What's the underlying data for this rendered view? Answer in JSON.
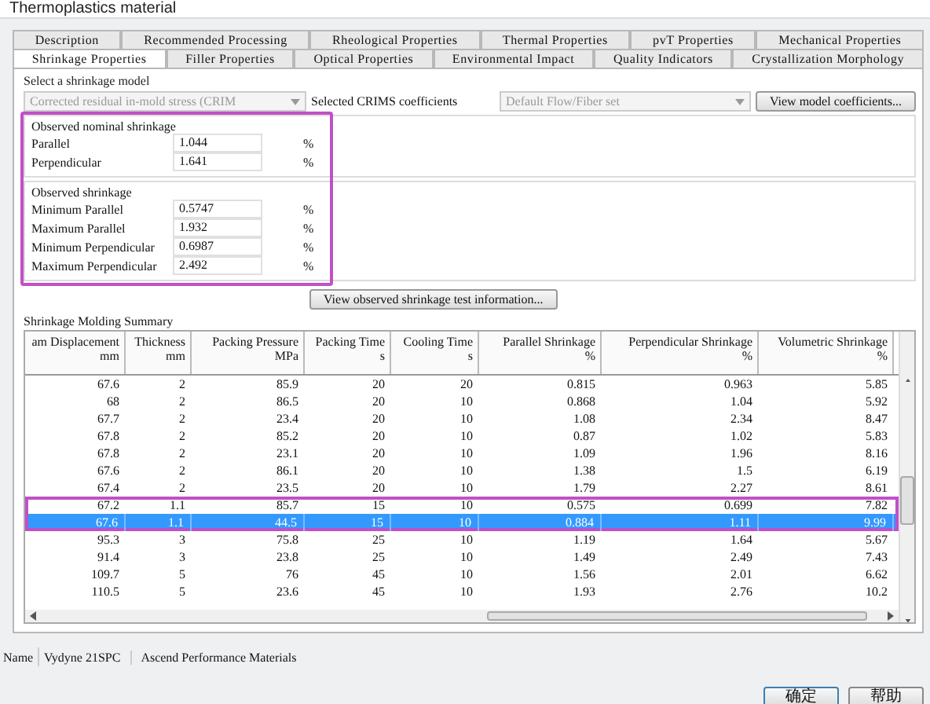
{
  "window": {
    "title": "Thermoplastics material"
  },
  "tab_rows": [
    {
      "tabs": [
        {
          "label": "Description",
          "selected": false
        },
        {
          "label": "Recommended Processing",
          "selected": false
        },
        {
          "label": "Rheological Properties",
          "selected": false
        },
        {
          "label": "Thermal Properties",
          "selected": false
        },
        {
          "label": "pvT Properties",
          "selected": false
        },
        {
          "label": "Mechanical Properties",
          "selected": false
        }
      ]
    },
    {
      "tabs": [
        {
          "label": "Shrinkage Properties",
          "selected": true
        },
        {
          "label": "Filler Properties",
          "selected": false
        },
        {
          "label": "Optical Properties",
          "selected": false
        },
        {
          "label": "Environmental Impact",
          "selected": false
        },
        {
          "label": "Quality Indicators",
          "selected": false
        },
        {
          "label": "Crystallization Morphology",
          "selected": false
        }
      ]
    }
  ],
  "shrinkage_model": {
    "label": "Select a shrinkage model",
    "model": {
      "value": "Corrected residual in-mold stress (CRIM",
      "disabled": true
    },
    "coefficients_label": "Selected CRIMS coefficients",
    "coefficients": {
      "value": "Default Flow/Fiber set",
      "disabled": true
    },
    "button": "View model coefficients..."
  },
  "observed": {
    "highlighted": true,
    "groups": [
      {
        "title": "Observed nominal shrinkage",
        "fields": [
          {
            "label": "Parallel",
            "value": "1.044",
            "unit": "%"
          },
          {
            "label": "Perpendicular",
            "value": "1.641",
            "unit": "%"
          }
        ]
      },
      {
        "title": "Observed shrinkage",
        "fields": [
          {
            "label": "Minimum Parallel",
            "value": "0.5747",
            "unit": "%"
          },
          {
            "label": "Maximum Parallel",
            "value": "1.932",
            "unit": "%"
          },
          {
            "label": "Minimum Perpendicular",
            "value": "0.6987",
            "unit": "%"
          },
          {
            "label": "Maximum Perpendicular",
            "value": "2.492",
            "unit": "%"
          }
        ]
      }
    ]
  },
  "test_info_button": "View observed shrinkage test information...",
  "summary": {
    "title": "Shrinkage Molding Summary",
    "columns": [
      {
        "name": "am Displacement",
        "unit": "mm"
      },
      {
        "name": "Thickness",
        "unit": "mm"
      },
      {
        "name": "Packing Pressure",
        "unit": "MPa"
      },
      {
        "name": "Packing Time",
        "unit": "s"
      },
      {
        "name": "Cooling Time",
        "unit": "s"
      },
      {
        "name": "Parallel Shrinkage",
        "unit": "%"
      },
      {
        "name": "Perpendicular Shrinkage",
        "unit": "%"
      },
      {
        "name": "Volumetric Shrinkage",
        "unit": "%"
      }
    ],
    "rows": [
      {
        "cells": [
          "67.6",
          "2",
          "85.9",
          "20",
          "20",
          "0.815",
          "0.963",
          "5.85"
        ],
        "selected": false,
        "highlighted": false
      },
      {
        "cells": [
          "68",
          "2",
          "86.5",
          "20",
          "10",
          "0.868",
          "1.04",
          "5.92"
        ],
        "selected": false,
        "highlighted": false
      },
      {
        "cells": [
          "67.7",
          "2",
          "23.4",
          "20",
          "10",
          "1.08",
          "2.34",
          "8.47"
        ],
        "selected": false,
        "highlighted": false
      },
      {
        "cells": [
          "67.8",
          "2",
          "85.2",
          "20",
          "10",
          "0.87",
          "1.02",
          "5.83"
        ],
        "selected": false,
        "highlighted": false
      },
      {
        "cells": [
          "67.8",
          "2",
          "23.1",
          "20",
          "10",
          "1.09",
          "1.96",
          "8.16"
        ],
        "selected": false,
        "highlighted": false
      },
      {
        "cells": [
          "67.6",
          "2",
          "86.1",
          "20",
          "10",
          "1.38",
          "1.5",
          "6.19"
        ],
        "selected": false,
        "highlighted": false
      },
      {
        "cells": [
          "67.4",
          "2",
          "23.5",
          "20",
          "10",
          "1.79",
          "2.27",
          "8.61"
        ],
        "selected": false,
        "highlighted": false
      },
      {
        "cells": [
          "67.2",
          "1.1",
          "85.7",
          "15",
          "10",
          "0.575",
          "0.699",
          "7.82"
        ],
        "selected": false,
        "highlighted": true
      },
      {
        "cells": [
          "67.6",
          "1.1",
          "44.5",
          "15",
          "10",
          "0.884",
          "1.11",
          "9.99"
        ],
        "selected": true,
        "highlighted": true
      },
      {
        "cells": [
          "95.3",
          "3",
          "75.8",
          "25",
          "10",
          "1.19",
          "1.64",
          "5.67"
        ],
        "selected": false,
        "highlighted": false
      },
      {
        "cells": [
          "91.4",
          "3",
          "23.8",
          "25",
          "10",
          "1.49",
          "2.49",
          "7.43"
        ],
        "selected": false,
        "highlighted": false
      },
      {
        "cells": [
          "109.7",
          "5",
          "76",
          "45",
          "10",
          "1.56",
          "2.01",
          "6.62"
        ],
        "selected": false,
        "highlighted": false
      },
      {
        "cells": [
          "110.5",
          "5",
          "23.6",
          "45",
          "10",
          "1.93",
          "2.76",
          "10.2"
        ],
        "selected": false,
        "highlighted": false
      }
    ]
  },
  "name": {
    "label": "Name",
    "value": "Vydyne 21SPC",
    "supplier": "Ascend Performance Materials"
  },
  "buttons": [
    "确定",
    "帮助"
  ]
}
